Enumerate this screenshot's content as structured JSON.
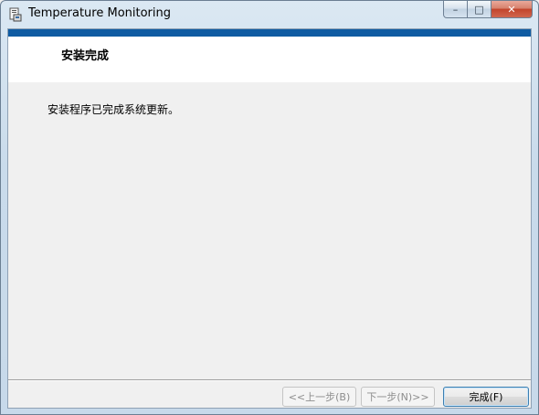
{
  "window": {
    "title": "Temperature Monitoring"
  },
  "caption": {
    "minimize": "–",
    "maximize": "□",
    "close": "✕"
  },
  "header": {
    "title": "安装完成"
  },
  "main": {
    "message": "安装程序已完成系统更新。"
  },
  "footer": {
    "back_label": "<<上一步(B)",
    "next_label": "下一步(N)>>",
    "finish_label": "完成(F)"
  },
  "colors": {
    "accent": "#0f5ba2"
  }
}
